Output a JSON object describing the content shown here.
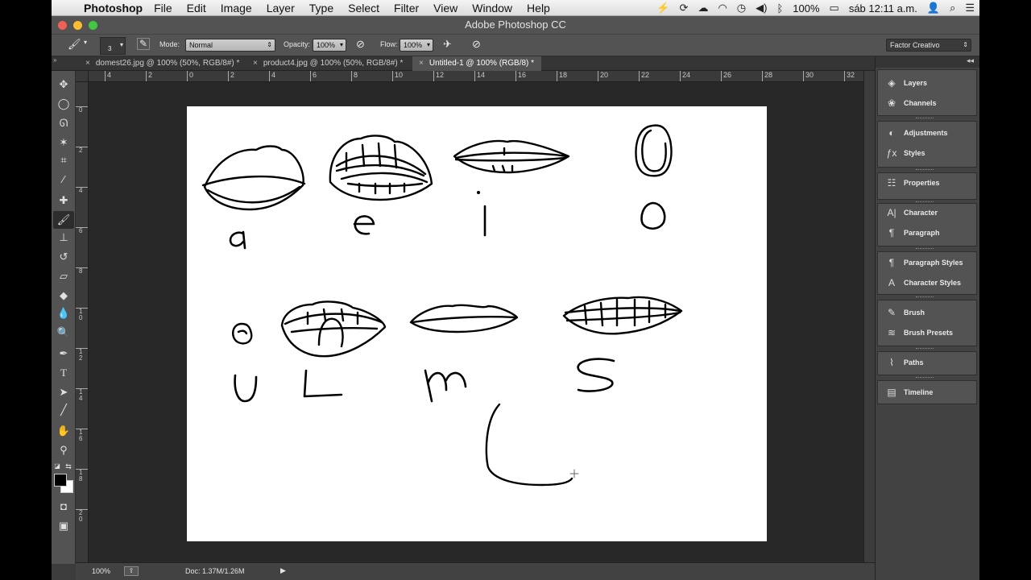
{
  "menubar": {
    "app_name": "Photoshop",
    "items": [
      "File",
      "Edit",
      "Image",
      "Layer",
      "Type",
      "Select",
      "Filter",
      "View",
      "Window",
      "Help"
    ],
    "battery": "100%",
    "clock": "sáb 12:11 a.m."
  },
  "window": {
    "title": "Adobe Photoshop CC"
  },
  "options_bar": {
    "brush_size": "3",
    "mode_label": "Mode:",
    "mode_value": "Normal",
    "opacity_label": "Opacity:",
    "opacity_value": "100%",
    "flow_label": "Flow:",
    "flow_value": "100%",
    "workspace": "Factor Creativo"
  },
  "tabs": [
    {
      "label": "domest26.jpg @ 100% (50%, RGB/8#) *"
    },
    {
      "label": "product4.jpg @ 100% (50%, RGB/8#) *"
    },
    {
      "label": "Untitled-1 @ 100% (RGB/8) *"
    }
  ],
  "ruler": {
    "h_labels": [
      "4",
      "2",
      "0",
      "2",
      "4",
      "6",
      "8",
      "10",
      "12",
      "14",
      "16",
      "18",
      "20",
      "22",
      "24",
      "26",
      "28",
      "30",
      "32"
    ],
    "v_labels": [
      "0",
      "2",
      "4",
      "6",
      "8",
      "1\n0",
      "1\n2",
      "1\n4",
      "1\n6",
      "1\n8",
      "2\n0"
    ]
  },
  "canvas": {
    "letters": [
      "a",
      "e",
      "i",
      "O",
      "U",
      "L",
      "m",
      "S"
    ]
  },
  "status": {
    "zoom": "100%",
    "doc": "Doc: 1.37M/1.26M"
  },
  "panels": [
    {
      "label": "Layers",
      "icon": "layers-icon"
    },
    {
      "label": "Channels",
      "icon": "channels-icon"
    },
    {
      "label": "Adjustments",
      "icon": "adjustments-icon"
    },
    {
      "label": "Styles",
      "icon": "styles-icon"
    },
    {
      "label": "Properties",
      "icon": "properties-icon"
    },
    {
      "label": "Character",
      "icon": "character-icon"
    },
    {
      "label": "Paragraph",
      "icon": "paragraph-icon"
    },
    {
      "label": "Paragraph Styles",
      "icon": "paragraph-styles-icon"
    },
    {
      "label": "Character Styles",
      "icon": "character-styles-icon"
    },
    {
      "label": "Brush",
      "icon": "brush-icon"
    },
    {
      "label": "Brush Presets",
      "icon": "brush-presets-icon"
    },
    {
      "label": "Paths",
      "icon": "paths-icon"
    },
    {
      "label": "Timeline",
      "icon": "timeline-icon"
    }
  ],
  "colors": {
    "foreground": "#000000",
    "background": "#ffffff",
    "ui_panel": "#535353",
    "pasteboard": "#282828"
  }
}
